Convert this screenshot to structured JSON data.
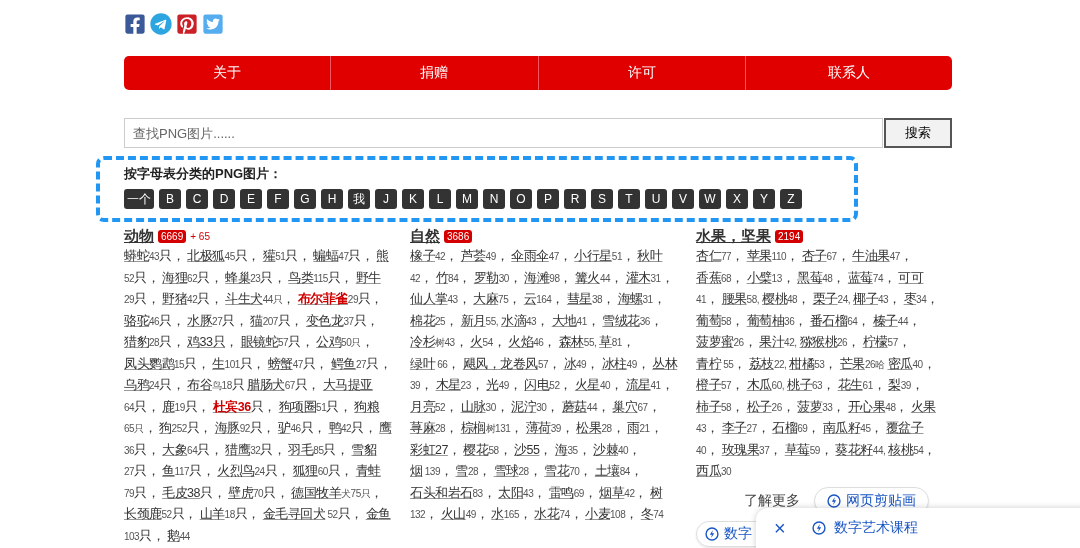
{
  "social": [
    {
      "kind": "facebook"
    },
    {
      "kind": "telegram"
    },
    {
      "kind": "pinterest"
    },
    {
      "kind": "twitter"
    }
  ],
  "nav": [
    "关于",
    "捐赠",
    "许可",
    "联系人"
  ],
  "search": {
    "placeholder": "查找PNG图片......",
    "button": "搜索"
  },
  "alphabet": {
    "title": "按字母表分类的PNG图片：",
    "letters": [
      "一个",
      "B",
      "C",
      "D",
      "E",
      "F",
      "G",
      "H",
      "我",
      "J",
      "K",
      "L",
      "M",
      "N",
      "O",
      "P",
      "R",
      "S",
      "T",
      "U",
      "V",
      "W",
      "X",
      "Y",
      "Z"
    ]
  },
  "columns": [
    {
      "title": "动物",
      "badge": "6669",
      "extra": "+ 65",
      "items": [
        {
          "name": "蟒蛇",
          "count": "43",
          "tail": "只，",
          "hot": false
        },
        {
          "name": "北极狐",
          "count": "45",
          "tail": "只，",
          "hot": false
        },
        {
          "name": "獾",
          "count": "51",
          "tail": "只，",
          "hot": false
        },
        {
          "name": "蝙蝠",
          "count": "47",
          "tail": "只，",
          "hot": false
        },
        {
          "name": "熊",
          "count": "52",
          "tail": "只，",
          "hot": false
        },
        {
          "name": "海狸",
          "count": "62",
          "tail": "只，",
          "hot": false
        },
        {
          "name": "蜂巢",
          "count": "23",
          "tail": "只，",
          "hot": false
        },
        {
          "name": "鸟类",
          "count": "115",
          "tail": "只，",
          "hot": false
        },
        {
          "name": "野牛",
          "count": "29",
          "tail": "只，",
          "hot": false
        },
        {
          "name": "野猪",
          "count": "42",
          "tail": "只，",
          "hot": false
        },
        {
          "name": "斗生犬",
          "count": "44只",
          "tail": "，",
          "hot": false
        },
        {
          "name": "布尔菲雀",
          "count": "29",
          "tail": "只，",
          "hot": true
        },
        {
          "name": "骆驼",
          "count": "46",
          "tail": "只，",
          "hot": false
        },
        {
          "name": "水豚",
          "count": "27",
          "tail": "只，",
          "hot": false
        },
        {
          "name": "猫",
          "count": "207",
          "tail": "只，",
          "hot": false
        },
        {
          "name": "变色龙",
          "count": "37",
          "tail": "只，",
          "hot": false
        },
        {
          "name": "猎豹",
          "count": "28",
          "tail": "只，",
          "hot": false
        },
        {
          "name": "鸡33只",
          "tail": "，",
          "hot": false
        },
        {
          "name": "眼镜蛇",
          "count": "57",
          "tail": "只，",
          "hot": false
        },
        {
          "name": "公鸡",
          "count": "50只",
          "tail": "，",
          "hot": false
        },
        {
          "name": "凤头鹦鹉",
          "count": "15",
          "tail": "只，",
          "hot": false
        },
        {
          "name": "生",
          "count": "101",
          "tail": "只，",
          "hot": false
        },
        {
          "name": "螃蟹",
          "count": "47",
          "tail": "只，",
          "hot": false
        },
        {
          "name": "鳄鱼",
          "count": "27",
          "tail": "只，",
          "hot": false
        },
        {
          "name": "乌鸦",
          "count": "24",
          "tail": "只，",
          "hot": false
        },
        {
          "name": "布谷",
          "count": "鸟18",
          "tail": "只",
          "hot": false
        },
        {
          "name": "腊肠犬",
          "count": "67",
          "tail": "只，",
          "hot": false
        },
        {
          "name": "大马提亚",
          "count": "64",
          "tail": "只，",
          "hot": false
        },
        {
          "name": "鹿",
          "count": "19",
          "tail": "只，",
          "hot": false
        },
        {
          "name": "杜宾36",
          "tail": "只，",
          "hot": true
        },
        {
          "name": "狗项圈",
          "count": "51",
          "tail": "只，",
          "hot": false
        },
        {
          "name": "狗粮",
          "count": "65只",
          "tail": "，",
          "hot": false
        },
        {
          "name": "狗",
          "count": "252",
          "tail": "只，",
          "hot": false
        },
        {
          "name": "海豚",
          "count": "92",
          "tail": "只，",
          "hot": false
        },
        {
          "name": "驴",
          "count": "46",
          "tail": "只，",
          "hot": false
        },
        {
          "name": "鸭",
          "count": "42",
          "tail": "只，",
          "hot": false
        },
        {
          "name": "鹰",
          "count": "36",
          "tail": "只，",
          "hot": false
        },
        {
          "name": "大象",
          "count": "64",
          "tail": "只，",
          "hot": false
        },
        {
          "name": "猎鹰",
          "count": "32",
          "tail": "只，",
          "hot": false
        },
        {
          "name": "羽毛",
          "count": "85",
          "tail": "只，",
          "hot": false
        },
        {
          "name": "雪貂",
          "count": "27",
          "tail": "只，",
          "hot": false
        },
        {
          "name": "鱼",
          "count": "117",
          "tail": "只，",
          "hot": false
        },
        {
          "name": "火烈鸟",
          "count": "24",
          "tail": "只，",
          "hot": false
        },
        {
          "name": "狐狸",
          "count": "60",
          "tail": "只，",
          "hot": false
        },
        {
          "name": "青蛙",
          "count": "79",
          "tail": "只，",
          "hot": false
        },
        {
          "name": "毛皮38",
          "tail": "只，",
          "hot": false
        },
        {
          "name": "壁虎",
          "count": "70",
          "tail": "只，",
          "hot": false
        },
        {
          "name": "德国牧羊",
          "count": "犬75只",
          "tail": "，",
          "hot": false
        },
        {
          "name": "长颈鹿",
          "count": "52",
          "tail": "只，",
          "hot": false
        },
        {
          "name": "山羊",
          "count": "18",
          "tail": "只，",
          "hot": false
        },
        {
          "name": "金毛寻回犬",
          "count": " 52",
          "tail": "只，",
          "hot": false
        },
        {
          "name": "金鱼",
          "count": "103",
          "tail": "只，",
          "hot": false
        },
        {
          "name": "鹅",
          "count": "44",
          "hot": false
        }
      ]
    },
    {
      "title": "自然",
      "badge": "3686",
      "items": [
        {
          "name": "橡子",
          "count": "42",
          "tail": "，",
          "hot": false
        },
        {
          "name": "芦荟",
          "count": "49",
          "tail": "，",
          "hot": false
        },
        {
          "name": "伞雨伞",
          "count": "47",
          "tail": "，",
          "hot": false
        },
        {
          "name": "小行星",
          "count": "51",
          "tail": "，",
          "hot": false
        },
        {
          "name": "秋叶",
          "count": "42",
          "tail": "，",
          "hot": false
        },
        {
          "name": "竹",
          "count": "84",
          "tail": "，",
          "hot": false
        },
        {
          "name": "罗勒",
          "count": "30",
          "tail": "，",
          "hot": false
        },
        {
          "name": "海滩",
          "count": "98",
          "tail": "，",
          "hot": false
        },
        {
          "name": "篝火",
          "count": "44",
          "tail": "，",
          "hot": false
        },
        {
          "name": "灌木",
          "count": "31",
          "tail": "，",
          "hot": false
        },
        {
          "name": "仙人掌",
          "count": "43",
          "tail": "，",
          "hot": false
        },
        {
          "name": "大麻",
          "count": "75",
          "tail": "，",
          "hot": false
        },
        {
          "name": "云",
          "count": "164",
          "tail": "，",
          "hot": false
        },
        {
          "name": "彗星",
          "count": "38",
          "tail": "，",
          "hot": false
        },
        {
          "name": "海螺",
          "count": "31",
          "tail": "，",
          "hot": false
        },
        {
          "name": "棉花",
          "count": "25",
          "tail": "，",
          "hot": false
        },
        {
          "name": "新月",
          "count": "55,",
          "hot": false
        },
        {
          "name": "水滴",
          "count": "43",
          "tail": "，",
          "hot": false
        },
        {
          "name": "大地",
          "count": "41",
          "tail": "，",
          "hot": false
        },
        {
          "name": "雪绒花",
          "count": "36",
          "tail": "，",
          "hot": false
        },
        {
          "name": "冷杉",
          "count": "树43",
          "tail": "，",
          "hot": false
        },
        {
          "name": "火",
          "count": "54",
          "tail": "，",
          "hot": false
        },
        {
          "name": "火焰",
          "count": "46",
          "tail": "，",
          "hot": false
        },
        {
          "name": "森林",
          "count": "55,",
          "hot": false
        },
        {
          "name": "草",
          "count": "81",
          "tail": "，",
          "hot": false
        },
        {
          "name": "绿叶",
          "count": " 66",
          "tail": "，",
          "hot": false
        },
        {
          "name": "飓风，龙卷风",
          "count": "57",
          "tail": "，",
          "hot": false
        },
        {
          "name": "冰",
          "count": "49",
          "tail": "，",
          "hot": false
        },
        {
          "name": "冰柱",
          "count": "49",
          "tail": "，",
          "hot": false
        },
        {
          "name": "丛林",
          "count": "39",
          "tail": "，",
          "hot": false
        },
        {
          "name": "木星",
          "count": "23",
          "tail": "，",
          "hot": false
        },
        {
          "name": "光",
          "count": "49",
          "tail": "，",
          "hot": false
        },
        {
          "name": "闪电",
          "count": "52",
          "tail": "，",
          "hot": false
        },
        {
          "name": "火星",
          "count": "40",
          "tail": "，",
          "hot": false
        },
        {
          "name": "流星",
          "count": "41",
          "tail": "，",
          "hot": false
        },
        {
          "name": "月亮",
          "count": "52",
          "tail": "，",
          "hot": false
        },
        {
          "name": "山脉",
          "count": "30",
          "tail": "，",
          "hot": false
        },
        {
          "name": "泥泞",
          "count": "30",
          "tail": "，",
          "hot": false
        },
        {
          "name": "蘑菇",
          "count": "44",
          "tail": "，",
          "hot": false
        },
        {
          "name": "巢穴",
          "count": "67",
          "tail": "，",
          "hot": false
        },
        {
          "name": "荨麻",
          "count": "28",
          "tail": "，",
          "hot": false
        },
        {
          "name": "棕榈",
          "count": "树131",
          "tail": "，",
          "hot": false
        },
        {
          "name": "薄荷",
          "count": "39",
          "tail": "，",
          "hot": false
        },
        {
          "name": "松果",
          "count": "28",
          "tail": "，",
          "hot": false
        },
        {
          "name": "雨",
          "count": "21",
          "tail": "，",
          "hot": false
        },
        {
          "name": "彩虹27",
          "tail": "，",
          "hot": false
        },
        {
          "name": "樱花",
          "count": "58",
          "tail": "，",
          "hot": false
        },
        {
          "name": "沙55",
          "tail": "，",
          "hot": false
        },
        {
          "name": "海",
          "count": "35",
          "tail": "，",
          "hot": false
        },
        {
          "name": "沙棘",
          "count": "40",
          "tail": "，",
          "hot": false
        },
        {
          "name": "烟",
          "count": " 139",
          "tail": "，",
          "hot": false
        },
        {
          "name": "雪",
          "count": "28",
          "tail": "，",
          "hot": false
        },
        {
          "name": "雪球",
          "count": "28",
          "tail": "，",
          "hot": false
        },
        {
          "name": "雪花",
          "count": "70",
          "tail": "，",
          "hot": false
        },
        {
          "name": "土壤",
          "count": "84",
          "tail": "，",
          "hot": false
        },
        {
          "name": "石头和岩石",
          "count": "83",
          "tail": "，",
          "hot": false
        },
        {
          "name": "太阳",
          "count": "43",
          "tail": "，",
          "hot": false
        },
        {
          "name": "雷鸣",
          "count": "69",
          "tail": "，",
          "hot": false
        },
        {
          "name": "烟草",
          "count": "42",
          "tail": "，",
          "hot": false
        },
        {
          "name": "树",
          "count": "132",
          "tail": "，",
          "hot": false
        },
        {
          "name": "火山",
          "count": "49",
          "tail": "，",
          "hot": false
        },
        {
          "name": "水",
          "count": "165",
          "tail": "，",
          "hot": false
        },
        {
          "name": "水花",
          "count": "74",
          "tail": "，",
          "hot": false
        },
        {
          "name": "小麦",
          "count": "108",
          "tail": "，",
          "hot": false
        },
        {
          "name": "冬",
          "count": "74",
          "hot": false
        }
      ]
    },
    {
      "title": "水果，坚果",
      "badge": "2194",
      "items": [
        {
          "name": "杏仁",
          "count": "77",
          "tail": "，",
          "hot": false
        },
        {
          "name": "苹果",
          "count": "110",
          "tail": "，",
          "hot": false
        },
        {
          "name": "杏子",
          "count": "67",
          "tail": "，",
          "hot": false
        },
        {
          "name": "牛油果",
          "count": "47",
          "tail": "，",
          "hot": false
        },
        {
          "name": "香蕉",
          "count": "68",
          "tail": "，",
          "hot": false
        },
        {
          "name": "小檗",
          "count": "13",
          "tail": "，",
          "hot": false
        },
        {
          "name": "黑莓",
          "count": "48",
          "tail": "，",
          "hot": false
        },
        {
          "name": "蓝莓",
          "count": "74",
          "tail": "，",
          "hot": false
        },
        {
          "name": "可可",
          "count": "41",
          "tail": "，",
          "hot": false
        },
        {
          "name": "腰果",
          "count": "58,",
          "hot": false
        },
        {
          "name": "樱桃",
          "count": "48",
          "tail": "，",
          "hot": false
        },
        {
          "name": "栗子",
          "count": "24,",
          "hot": false
        },
        {
          "name": "椰子",
          "count": "43",
          "tail": "，",
          "hot": false
        },
        {
          "name": "枣",
          "count": "34",
          "tail": "，",
          "hot": false
        },
        {
          "name": "葡萄",
          "count": "58",
          "tail": "，",
          "hot": false
        },
        {
          "name": "葡萄柚",
          "count": "36",
          "tail": "，",
          "hot": false
        },
        {
          "name": "番石榴",
          "count": "64",
          "tail": "，",
          "hot": false
        },
        {
          "name": "榛子",
          "count": "44",
          "tail": "，",
          "hot": false
        },
        {
          "name": "菠萝蜜",
          "count": "26",
          "tail": "，",
          "hot": false
        },
        {
          "name": "果汁",
          "count": "42,",
          "hot": false
        },
        {
          "name": "猕猴桃",
          "count": "26",
          "tail": "，",
          "hot": false
        },
        {
          "name": "柠檬",
          "count": "57",
          "tail": "，",
          "hot": false
        },
        {
          "name": "青柠",
          "count": " 55",
          "tail": "，",
          "hot": false
        },
        {
          "name": "荔枝",
          "count": "22,",
          "hot": false
        },
        {
          "name": "柑橘",
          "count": "53",
          "tail": "，",
          "hot": false
        },
        {
          "name": "芒果",
          "count": "26哈",
          "hot": false
        },
        {
          "name": "密瓜",
          "count": "40",
          "tail": "，",
          "hot": false
        },
        {
          "name": "橙子",
          "count": "57",
          "tail": "，",
          "hot": false
        },
        {
          "name": "木瓜",
          "count": "60,",
          "hot": false
        },
        {
          "name": "桃子",
          "count": "63",
          "tail": "，",
          "hot": false
        },
        {
          "name": "花生",
          "count": "61",
          "tail": "，",
          "hot": false
        },
        {
          "name": "梨",
          "count": "39",
          "tail": "，",
          "hot": false
        },
        {
          "name": "柿子",
          "count": "58",
          "tail": "，",
          "hot": false
        },
        {
          "name": "松子",
          "count": "26",
          "tail": "，",
          "hot": false
        },
        {
          "name": "菠萝",
          "count": "33",
          "tail": "，",
          "hot": false
        },
        {
          "name": "开心果",
          "count": "48",
          "tail": "，",
          "hot": false
        },
        {
          "name": "火果",
          "count": "43",
          "tail": "，",
          "hot": false
        },
        {
          "name": "李子",
          "count": "27",
          "tail": "，",
          "hot": false
        },
        {
          "name": "石榴",
          "count": "69",
          "tail": "，",
          "hot": false
        },
        {
          "name": "南瓜籽",
          "count": "45",
          "tail": "，",
          "hot": false
        },
        {
          "name": "覆盆子",
          "count": "40",
          "tail": "，",
          "hot": false
        },
        {
          "name": "玫瑰果",
          "count": "37",
          "tail": "，",
          "hot": false
        },
        {
          "name": "草莓",
          "count": "59",
          "tail": "，",
          "hot": false
        },
        {
          "name": "葵花籽",
          "count": "44,",
          "hot": false
        },
        {
          "name": "核桃",
          "count": "54",
          "tail": "，",
          "hot": false
        },
        {
          "name": "西瓜",
          "count": "30",
          "hot": false
        }
      ]
    }
  ],
  "related": {
    "label": "了解更多",
    "chips": [
      "网页剪贴画",
      "数字"
    ]
  },
  "popup": {
    "close": "×",
    "link": "数字艺术课程"
  }
}
